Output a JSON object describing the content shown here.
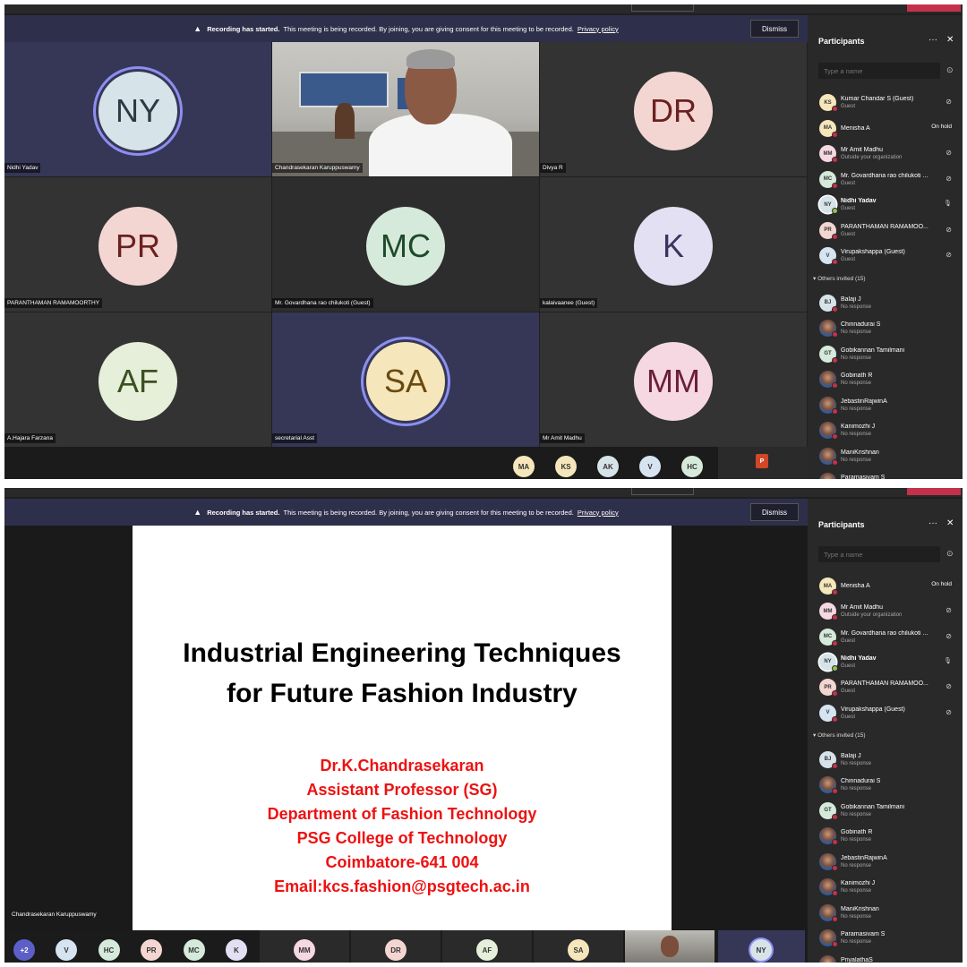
{
  "banner": {
    "bold": "Recording has started.",
    "text": "This meeting is being recorded. By joining, you are giving consent for this meeting to be recorded.",
    "link": "Privacy policy",
    "dismiss": "Dismiss"
  },
  "top": {
    "tiles": [
      {
        "initials": "NY",
        "name": "Nidhi Yadav",
        "color": "#d6e4ea",
        "text": "#2b3a44",
        "ring": true
      },
      {
        "video": true,
        "name": "Chandrasekaran Karuppuswamy"
      },
      {
        "initials": "DR",
        "name": "Divya R",
        "color": "#f3d6d2",
        "text": "#6b2020"
      },
      {
        "initials": "PR",
        "name": "PARANTHAMAN RAMAMOORTHY",
        "color": "#f3d6d2",
        "text": "#6b2020"
      },
      {
        "initials": "MC",
        "name": "Mr. Govardhana rao chilukoti (Guest)",
        "color": "#d6eadb",
        "text": "#1f4a2a"
      },
      {
        "initials": "K",
        "name": "kalaivaanee (Guest)",
        "color": "#e2e0f2",
        "text": "#3a3560"
      },
      {
        "initials": "AF",
        "name": "A.Hajara Farzana",
        "color": "#e6efd9",
        "text": "#3b5021"
      },
      {
        "initials": "SA",
        "name": "secretarial Asst",
        "color": "#f6e6bb",
        "text": "#6a4a10",
        "ring": true
      },
      {
        "initials": "MM",
        "name": "Mr Amit Madhu",
        "color": "#f6d8e2",
        "text": "#6b1f3a"
      }
    ],
    "bottom_avatars": [
      "MA",
      "KS",
      "AK",
      "V",
      "HC"
    ]
  },
  "panel": {
    "title": "Participants",
    "search_placeholder": "Type a name",
    "others_label": "Others invited (15)",
    "top_list": [
      {
        "initials": "KS",
        "name": "Kumar Chandar S (Guest)",
        "sub": "Guest",
        "icon": "muted"
      },
      {
        "initials": "MA",
        "name": "Menisha A",
        "sub": "",
        "onhold": "On hold"
      },
      {
        "initials": "MM",
        "name": "Mr Amit Madhu",
        "sub": "Outside your organization",
        "icon": "muted"
      },
      {
        "initials": "MC",
        "name": "Mr. Govardhana rao chilukoti ...",
        "sub": "Guest",
        "icon": "muted"
      },
      {
        "initials": "NY",
        "name": "Nidhi Yadav",
        "sub": "Guest",
        "icon": "mic",
        "bold": true
      },
      {
        "initials": "PR",
        "name": "PARANTHAMAN RAMAMOO...",
        "sub": "Guest",
        "icon": "muted"
      },
      {
        "initials": "V",
        "name": "Virupakshappa (Guest)",
        "sub": "Guest",
        "icon": "muted"
      }
    ],
    "top_invited": [
      {
        "initials": "BJ",
        "name": "Balaji J",
        "sub": "No response"
      },
      {
        "initials": "",
        "name": "Chinnadurai S",
        "sub": "No response",
        "photo": true
      },
      {
        "initials": "GT",
        "name": "Gobikannan Tamilmani",
        "sub": "No response"
      },
      {
        "initials": "",
        "name": "Gobinath R",
        "sub": "No response",
        "photo": true
      },
      {
        "initials": "",
        "name": "JebastinRajwinA",
        "sub": "No response",
        "photo": true
      },
      {
        "initials": "",
        "name": "Kanimozhi J",
        "sub": "No response",
        "photo": true
      },
      {
        "initials": "",
        "name": "ManiKrishnan",
        "sub": "No response",
        "photo": true
      },
      {
        "initials": "",
        "name": "Paramasivam S",
        "sub": "No response",
        "photo": true
      }
    ],
    "bottom_list": [
      {
        "initials": "MA",
        "name": "Menisha A",
        "sub": "",
        "onhold": "On hold"
      },
      {
        "initials": "MM",
        "name": "Mr Amit Madhu",
        "sub": "Outside your organization",
        "icon": "muted"
      },
      {
        "initials": "MC",
        "name": "Mr. Govardhana rao chilukoti ...",
        "sub": "Guest",
        "icon": "muted"
      },
      {
        "initials": "NY",
        "name": "Nidhi Yadav",
        "sub": "Guest",
        "icon": "mic",
        "bold": true
      },
      {
        "initials": "PR",
        "name": "PARANTHAMAN RAMAMOO...",
        "sub": "Guest",
        "icon": "muted"
      },
      {
        "initials": "V",
        "name": "Virupakshappa (Guest)",
        "sub": "Guest",
        "icon": "muted"
      }
    ],
    "bottom_invited": [
      {
        "initials": "BJ",
        "name": "Balaji J",
        "sub": "No response"
      },
      {
        "initials": "",
        "name": "Chinnadurai S",
        "sub": "No response",
        "photo": true
      },
      {
        "initials": "GT",
        "name": "Gobikannan Tamilmani",
        "sub": "No response"
      },
      {
        "initials": "",
        "name": "Gobinath R",
        "sub": "No response",
        "photo": true
      },
      {
        "initials": "",
        "name": "JebastinRajwinA",
        "sub": "No response",
        "photo": true
      },
      {
        "initials": "",
        "name": "Kanimozhi J",
        "sub": "No response",
        "photo": true
      },
      {
        "initials": "",
        "name": "ManiKrishnan",
        "sub": "No response",
        "photo": true
      },
      {
        "initials": "",
        "name": "Paramasivam S",
        "sub": "No response",
        "photo": true
      },
      {
        "initials": "",
        "name": "PriyalathaS",
        "sub": "No response",
        "photo": true
      }
    ]
  },
  "slide": {
    "title_lines": [
      "Industrial Engineering Techniques",
      "for Future Fashion Industry"
    ],
    "author_lines": [
      "Dr.K.Chandrasekaran",
      "Assistant Professor (SG)",
      "Department of Fashion Technology",
      "PSG College of Technology",
      "Coimbatore-641 004",
      "Email:kcs.fashion@psgtech.ac.in"
    ],
    "presenter": "Chandrasekaran Karuppuswamy"
  },
  "bottom_strip": {
    "more": "+2",
    "avatars": [
      "V",
      "HC",
      "PR",
      "MC",
      "K"
    ],
    "tiles": [
      "MM",
      "DR",
      "AF",
      "SA"
    ],
    "last": "NY"
  },
  "colors": {
    "KS": "#f6e6bb",
    "MA": "#f6e6bb",
    "MM": "#f6d8e2",
    "MC": "#d6eadb",
    "NY": "#d6e4ea",
    "PR": "#f3d6d2",
    "V": "#d6e4f2",
    "BJ": "#d6e4ea",
    "GT": "#d6eadb",
    "AK": "#d6e4ea",
    "HC": "#d6eadb",
    "K": "#e2e0f2",
    "DR": "#f3d6d2",
    "AF": "#e6efd9",
    "SA": "#f6e6bb",
    "more": "#5b5fc7"
  }
}
